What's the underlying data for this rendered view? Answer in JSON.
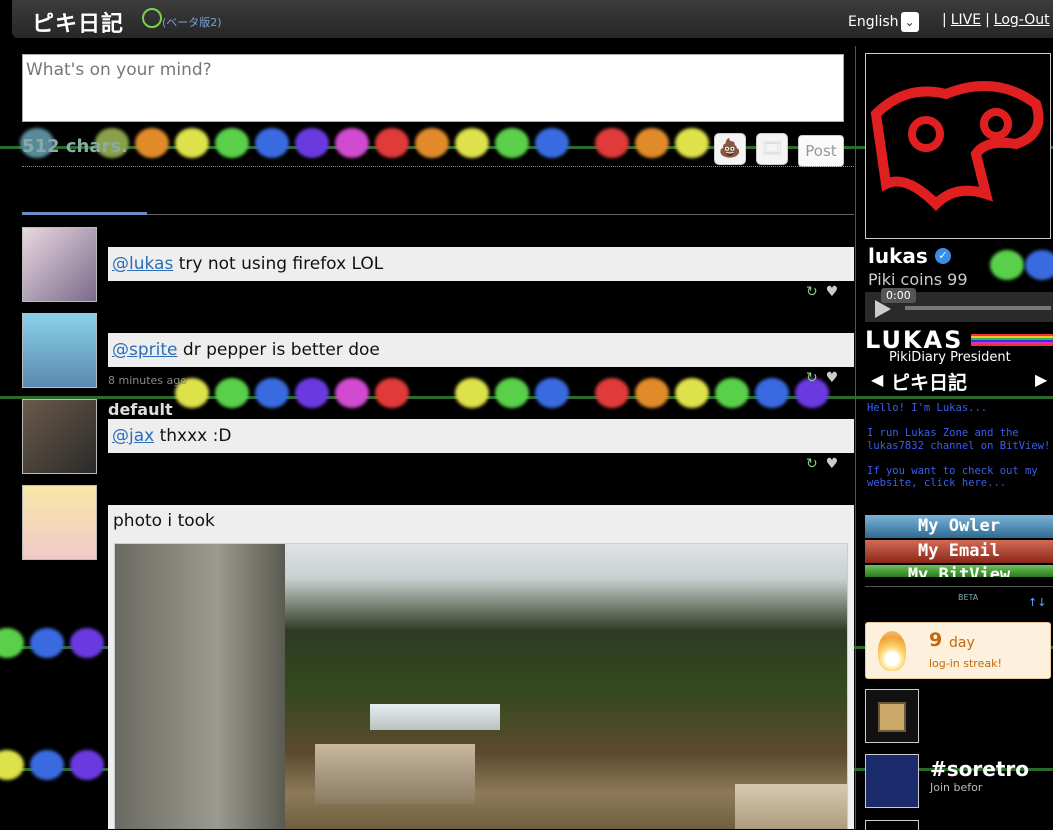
{
  "app": {
    "logo_text": "ピキ日記",
    "logo_sub": "(ベータ版2)",
    "language": "English",
    "links": [
      "LIVE",
      "Log-Out"
    ]
  },
  "composer": {
    "placeholder": "What's on your mind?",
    "char_count": "512 chars.",
    "post_label": "Post",
    "icons": [
      "poop-icon",
      "film-icon"
    ]
  },
  "posts": [
    {
      "mention": "@lukas",
      "text": " try not using firefox LOL",
      "meta": "",
      "actions": "↻"
    },
    {
      "mention": "@sprite",
      "text": " dr pepper is better doe",
      "meta": "8 minutes ago",
      "actions": "↻"
    },
    {
      "username": "default",
      "mention": "@jax",
      "text": " thxxx :D",
      "actions": "↻"
    },
    {
      "caption": "photo i took"
    }
  ],
  "profile": {
    "name": "lukas",
    "coins": "Piki coins 99",
    "audio_time": "0:00",
    "banner_name": "LUKAS",
    "banner_title": "PikiDiary President",
    "nav_logo": "ピキ日記",
    "bio": "Hello! I'm Lukas...\n\nI run Lukas Zone and the lukas7832 channel on BitView!\n\nIf you want to check out my website, click here...",
    "buttons": [
      "My Owler",
      "My Email",
      "My BitView"
    ],
    "beta": "BETA"
  },
  "streak": {
    "number": "9",
    "unit": "day",
    "label": "log-in streak!"
  },
  "group": {
    "name": "#soretro",
    "sub": "Join befor"
  },
  "colors": {
    "accent": "#6a8ec4",
    "link": "#2a6fb8",
    "streak": "#c06a10"
  }
}
